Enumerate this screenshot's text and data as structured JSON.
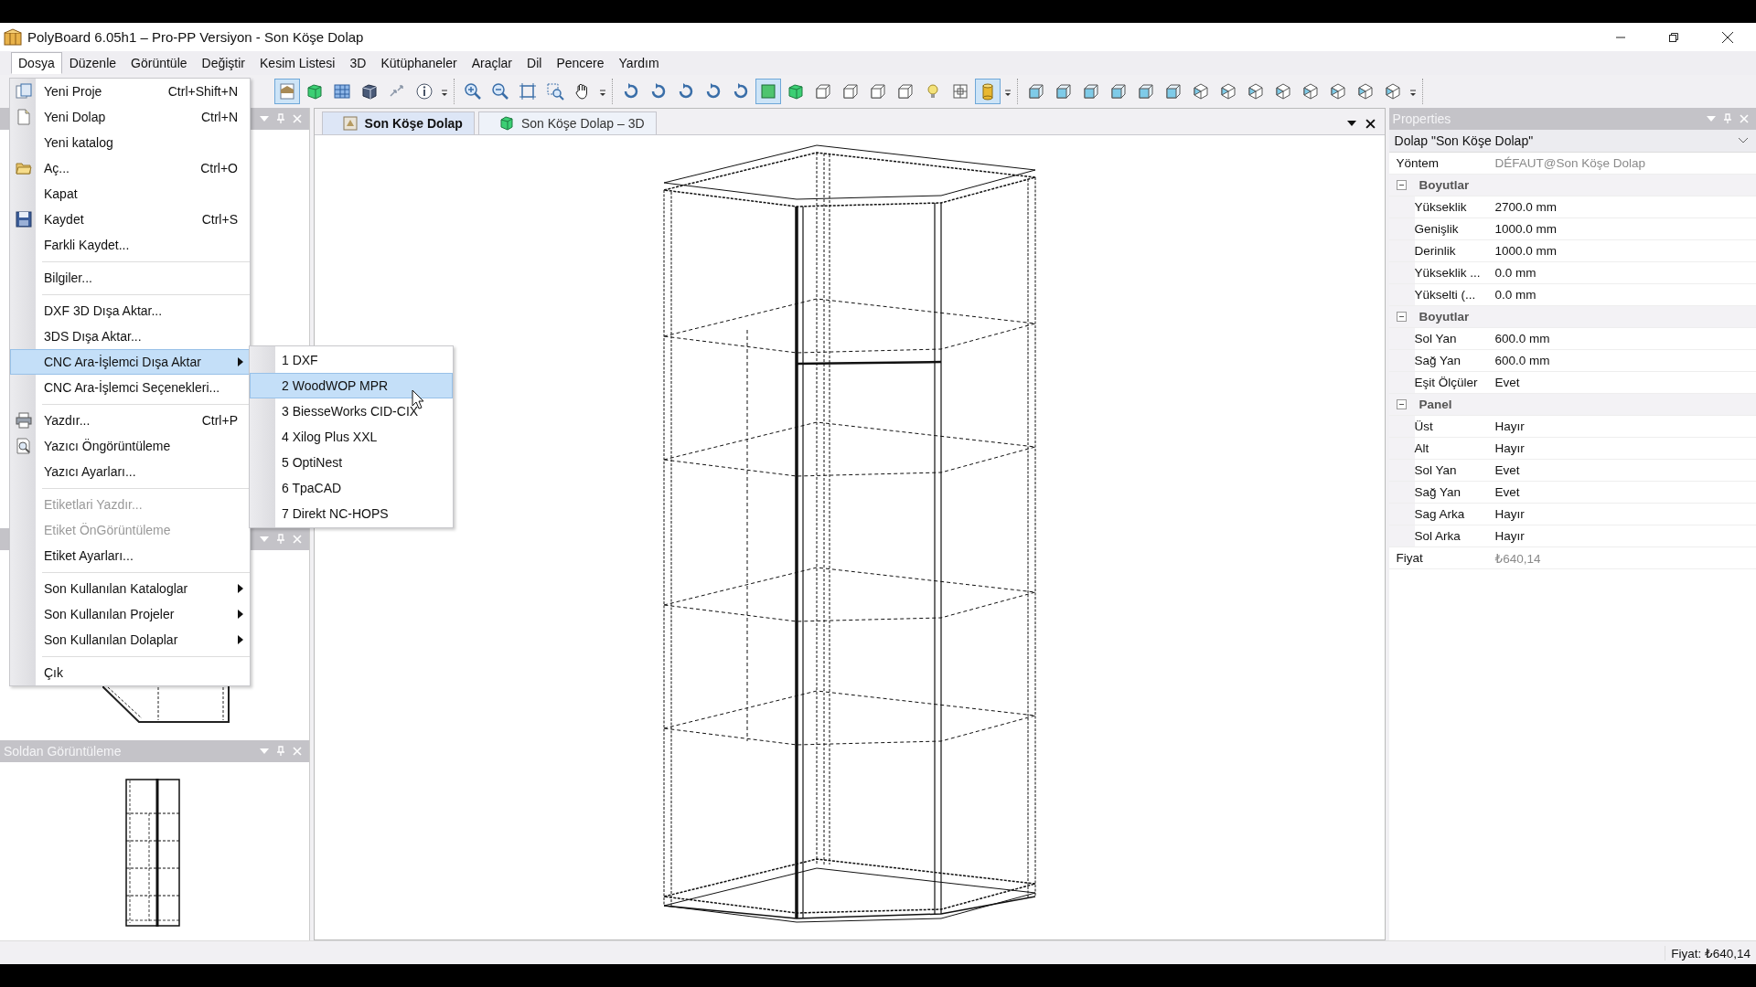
{
  "window": {
    "title": "PolyBoard 6.05h1 – Pro-PP Versiyon - Son Köşe Dolap"
  },
  "menu_bar": [
    {
      "label": "Dosya",
      "selected": true
    },
    {
      "label": "Düzenle",
      "selected": false
    },
    {
      "label": "Görüntüle",
      "selected": false
    },
    {
      "label": "Değiştir",
      "selected": false
    },
    {
      "label": "Kesim Listesi",
      "selected": false
    },
    {
      "label": "3D",
      "selected": false
    },
    {
      "label": "Kütüphaneler",
      "selected": false
    },
    {
      "label": "Araçlar",
      "selected": false
    },
    {
      "label": "Dil",
      "selected": false
    },
    {
      "label": "Pencere",
      "selected": false
    },
    {
      "label": "Yardım",
      "selected": false
    }
  ],
  "toolbar": {
    "groups": [
      {
        "items": [
          {
            "kind": "page",
            "pressed": true
          },
          {
            "kind": "cube",
            "pressed": false
          },
          {
            "kind": "grid",
            "pressed": false
          },
          {
            "kind": "cube-dark",
            "pressed": false
          },
          {
            "kind": "arrows",
            "pressed": false
          },
          {
            "kind": "info",
            "pressed": false
          }
        ]
      },
      {
        "items": [
          {
            "kind": "zoom-in",
            "pressed": false
          },
          {
            "kind": "zoom-out",
            "pressed": false
          },
          {
            "kind": "zoom-extents",
            "pressed": false
          },
          {
            "kind": "zoom-window",
            "pressed": false
          },
          {
            "kind": "hand",
            "pressed": false
          }
        ]
      },
      {
        "items": [
          {
            "kind": "rotate",
            "pressed": false
          },
          {
            "kind": "rotate",
            "pressed": false
          },
          {
            "kind": "rotate",
            "pressed": false
          },
          {
            "kind": "rotate",
            "pressed": false
          },
          {
            "kind": "rotate",
            "pressed": false
          },
          {
            "kind": "square",
            "pressed": true
          },
          {
            "kind": "cube",
            "pressed": false
          },
          {
            "kind": "box",
            "pressed": false
          },
          {
            "kind": "box",
            "pressed": false
          },
          {
            "kind": "box",
            "pressed": false
          },
          {
            "kind": "box",
            "pressed": false
          },
          {
            "kind": "bulb",
            "pressed": false
          },
          {
            "kind": "frame",
            "pressed": false
          },
          {
            "kind": "cylinder",
            "pressed": true
          }
        ]
      },
      {
        "items": [
          {
            "kind": "box-blue",
            "pressed": false
          },
          {
            "kind": "box-blue",
            "pressed": false
          },
          {
            "kind": "box-blue",
            "pressed": false
          },
          {
            "kind": "box-blue",
            "pressed": false
          },
          {
            "kind": "box-blue",
            "pressed": false
          },
          {
            "kind": "box-blue",
            "pressed": false
          },
          {
            "kind": "iso",
            "pressed": false
          },
          {
            "kind": "iso",
            "pressed": false
          },
          {
            "kind": "iso",
            "pressed": false
          },
          {
            "kind": "iso",
            "pressed": false
          },
          {
            "kind": "iso",
            "pressed": false
          },
          {
            "kind": "iso",
            "pressed": false
          },
          {
            "kind": "iso",
            "pressed": false
          },
          {
            "kind": "iso",
            "pressed": false
          }
        ]
      }
    ]
  },
  "file_menu": [
    {
      "kind": "item",
      "label": "Yeni Proje",
      "shortcut": "Ctrl+Shift+N",
      "disabled": false,
      "submenu": false,
      "selected": false
    },
    {
      "kind": "item",
      "label": "Yeni Dolap",
      "shortcut": "Ctrl+N",
      "disabled": false,
      "submenu": false,
      "selected": false
    },
    {
      "kind": "item",
      "label": "Yeni katalog",
      "disabled": false,
      "submenu": false,
      "selected": false
    },
    {
      "kind": "item",
      "label": "Aç...",
      "shortcut": "Ctrl+O",
      "disabled": false,
      "submenu": false,
      "selected": false
    },
    {
      "kind": "item",
      "label": "Kapat",
      "disabled": false,
      "submenu": false,
      "selected": false
    },
    {
      "kind": "item",
      "label": "Kaydet",
      "shortcut": "Ctrl+S",
      "disabled": false,
      "submenu": false,
      "selected": false
    },
    {
      "kind": "item",
      "label": "Farkli Kaydet...",
      "disabled": false,
      "submenu": false,
      "selected": false
    },
    {
      "kind": "separator"
    },
    {
      "kind": "item",
      "label": "Bilgiler...",
      "disabled": false,
      "submenu": false,
      "selected": false
    },
    {
      "kind": "separator"
    },
    {
      "kind": "item",
      "label": "DXF 3D Dışa Aktar...",
      "disabled": false,
      "submenu": false,
      "selected": false
    },
    {
      "kind": "item",
      "label": "3DS Dışa Aktar...",
      "disabled": false,
      "submenu": false,
      "selected": false
    },
    {
      "kind": "item",
      "label": "CNC Ara-İşlemci Dışa Aktar",
      "disabled": false,
      "submenu": true,
      "selected": true
    },
    {
      "kind": "item",
      "label": "CNC Ara-İşlemci Seçenekleri...",
      "disabled": false,
      "submenu": false,
      "selected": false
    },
    {
      "kind": "separator"
    },
    {
      "kind": "item",
      "label": "Yazdır...",
      "shortcut": "Ctrl+P",
      "disabled": false,
      "submenu": false,
      "selected": false
    },
    {
      "kind": "item",
      "label": "Yazıcı Öngörüntüleme",
      "disabled": false,
      "submenu": false,
      "selected": false
    },
    {
      "kind": "item",
      "label": "Yazıcı Ayarları...",
      "disabled": false,
      "submenu": false,
      "selected": false
    },
    {
      "kind": "separator"
    },
    {
      "kind": "item",
      "label": "Etiketlari Yazdır...",
      "disabled": true,
      "submenu": false,
      "selected": false
    },
    {
      "kind": "item",
      "label": "Etiket ÖnGörüntüleme",
      "disabled": true,
      "submenu": false,
      "selected": false
    },
    {
      "kind": "item",
      "label": "Etiket Ayarları...",
      "disabled": false,
      "submenu": false,
      "selected": false
    },
    {
      "kind": "separator"
    },
    {
      "kind": "item",
      "label": "Son Kullanılan Kataloglar",
      "disabled": false,
      "submenu": true,
      "selected": false
    },
    {
      "kind": "item",
      "label": "Son Kullanılan Projeler",
      "disabled": false,
      "submenu": true,
      "selected": false
    },
    {
      "kind": "item",
      "label": "Son Kullanılan Dolaplar",
      "disabled": false,
      "submenu": true,
      "selected": false
    },
    {
      "kind": "separator"
    },
    {
      "kind": "item",
      "label": "Çık",
      "disabled": false,
      "submenu": false,
      "selected": false
    }
  ],
  "export_submenu": [
    {
      "label": "1 DXF",
      "selected": false
    },
    {
      "label": "2 WoodWOP MPR",
      "selected": true
    },
    {
      "label": "3 BiesseWorks CID-CIX",
      "selected": false
    },
    {
      "label": "4 Xilog Plus XXL",
      "selected": false
    },
    {
      "label": "5 OptiNest",
      "selected": false
    },
    {
      "label": "6 TpaCAD",
      "selected": false
    },
    {
      "label": "7 Direkt NC-HOPS",
      "selected": false
    }
  ],
  "left_view_panel": {
    "title": "Soldan Görüntüleme"
  },
  "document_tabs": [
    {
      "label": "Son Köşe Dolap",
      "selected": true,
      "kind": "drawing"
    },
    {
      "label": "Son Köşe Dolap – 3D",
      "selected": false,
      "kind": "model"
    }
  ],
  "properties": {
    "title": "Properties",
    "object": "Dolap \"Son Köşe Dolap\"",
    "rows": [
      {
        "kind": "property",
        "name": "Yöntem",
        "value": "DÉFAUT@Son Köşe Dolap",
        "readonly": true
      },
      {
        "kind": "category",
        "name": "Boyutlar",
        "expanded": true,
        "children": [
          {
            "name": "Yükseklik",
            "value": "2700.0 mm"
          },
          {
            "name": "Genişlik",
            "value": "1000.0 mm"
          },
          {
            "name": "Derinlik",
            "value": "1000.0 mm"
          },
          {
            "name": "Yükseklik ...",
            "value": "0.0 mm"
          },
          {
            "name": "Yükselti (...",
            "value": "0.0 mm"
          }
        ]
      },
      {
        "kind": "category",
        "name": "Boyutlar",
        "expanded": true,
        "children": [
          {
            "name": "Sol Yan",
            "value": "600.0 mm"
          },
          {
            "name": "Sağ Yan",
            "value": "600.0 mm"
          },
          {
            "name": "Eşit Ölçüler",
            "value": "Evet"
          }
        ]
      },
      {
        "kind": "category",
        "name": "Panel",
        "expanded": true,
        "children": [
          {
            "name": "Üst",
            "value": "Hayır"
          },
          {
            "name": "Alt",
            "value": "Hayır"
          },
          {
            "name": "Sol Yan",
            "value": "Evet"
          },
          {
            "name": "Sağ Yan",
            "value": "Evet"
          },
          {
            "name": "Sag Arka",
            "value": "Hayır"
          },
          {
            "name": "Sol Arka",
            "value": "Hayır"
          }
        ]
      },
      {
        "kind": "property",
        "name": "Fiyat",
        "value": "₺640,14",
        "readonly": true
      }
    ]
  },
  "status_bar": {
    "price": "Fiyat: ₺640,14"
  }
}
